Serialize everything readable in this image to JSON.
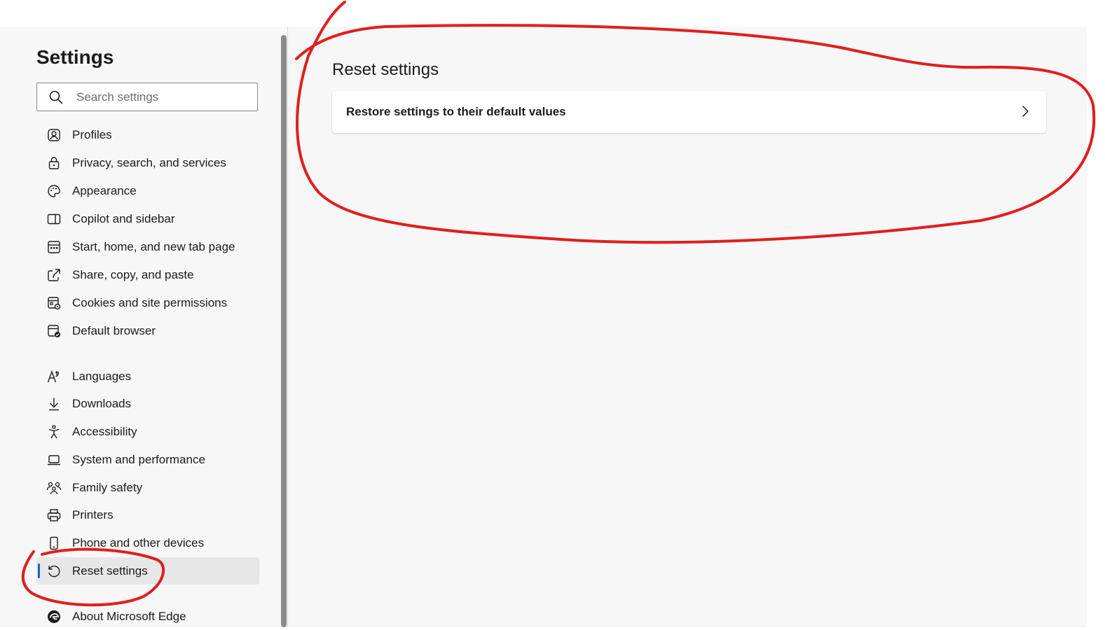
{
  "sidebar": {
    "title": "Settings",
    "search": {
      "placeholder": "Search settings",
      "value": ""
    },
    "items": [
      {
        "label": "Profiles",
        "icon": "profile-icon"
      },
      {
        "label": "Privacy, search, and services",
        "icon": "lock-icon"
      },
      {
        "label": "Appearance",
        "icon": "palette-icon"
      },
      {
        "label": "Copilot and sidebar",
        "icon": "sidebar-icon"
      },
      {
        "label": "Start, home, and new tab page",
        "icon": "home-tabs-icon"
      },
      {
        "label": "Share, copy, and paste",
        "icon": "share-icon"
      },
      {
        "label": "Cookies and site permissions",
        "icon": "cookies-icon"
      },
      {
        "label": "Default browser",
        "icon": "default-browser-icon"
      },
      {
        "label": "Languages",
        "icon": "languages-icon"
      },
      {
        "label": "Downloads",
        "icon": "download-icon"
      },
      {
        "label": "Accessibility",
        "icon": "accessibility-icon"
      },
      {
        "label": "System and performance",
        "icon": "laptop-icon"
      },
      {
        "label": "Family safety",
        "icon": "family-icon"
      },
      {
        "label": "Printers",
        "icon": "printer-icon"
      },
      {
        "label": "Phone and other devices",
        "icon": "phone-icon"
      },
      {
        "label": "Reset settings",
        "icon": "reset-icon",
        "active": true
      },
      {
        "label": "About Microsoft Edge",
        "icon": "edge-logo-icon"
      }
    ]
  },
  "main": {
    "section_title": "Reset settings",
    "card": {
      "label": "Restore settings to their default values"
    }
  },
  "colors": {
    "accent": "#0f6cbd",
    "annotation": "#e01e1e",
    "background": "#f7f7f7",
    "active_item": "#e7e7e7"
  }
}
